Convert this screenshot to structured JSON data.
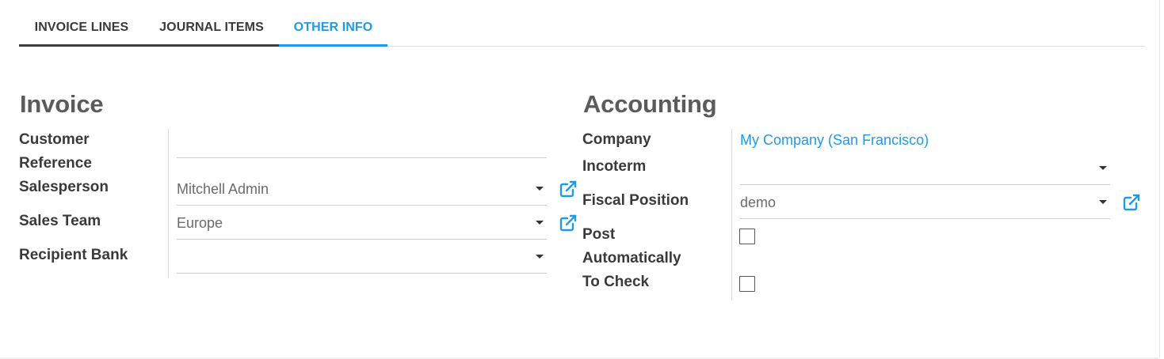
{
  "tabs": [
    {
      "label": "INVOICE LINES",
      "active": false
    },
    {
      "label": "JOURNAL ITEMS",
      "active": false
    },
    {
      "label": "OTHER INFO",
      "active": true
    }
  ],
  "invoice": {
    "title": "Invoice",
    "customer_reference": {
      "label_line1": "Customer",
      "label_line2": "Reference",
      "value": ""
    },
    "salesperson": {
      "label": "Salesperson",
      "value": "Mitchell Admin"
    },
    "sales_team": {
      "label": "Sales Team",
      "value": "Europe"
    },
    "recipient_bank": {
      "label": "Recipient Bank",
      "value": ""
    }
  },
  "accounting": {
    "title": "Accounting",
    "company": {
      "label": "Company",
      "value": "My Company (San Francisco)"
    },
    "incoterm": {
      "label": "Incoterm",
      "value": ""
    },
    "fiscal_position": {
      "label": "Fiscal Position",
      "value": "demo"
    },
    "post_automatically": {
      "label_line1": "Post",
      "label_line2": "Automatically",
      "checked": false
    },
    "to_check": {
      "label": "To Check",
      "checked": false
    }
  },
  "colors": {
    "accent": "#1f9ae8",
    "text": "#3a3a3a",
    "muted": "#6b6b6b"
  },
  "icons": {
    "external_link": "external-link-icon",
    "dropdown": "caret-down-icon"
  }
}
